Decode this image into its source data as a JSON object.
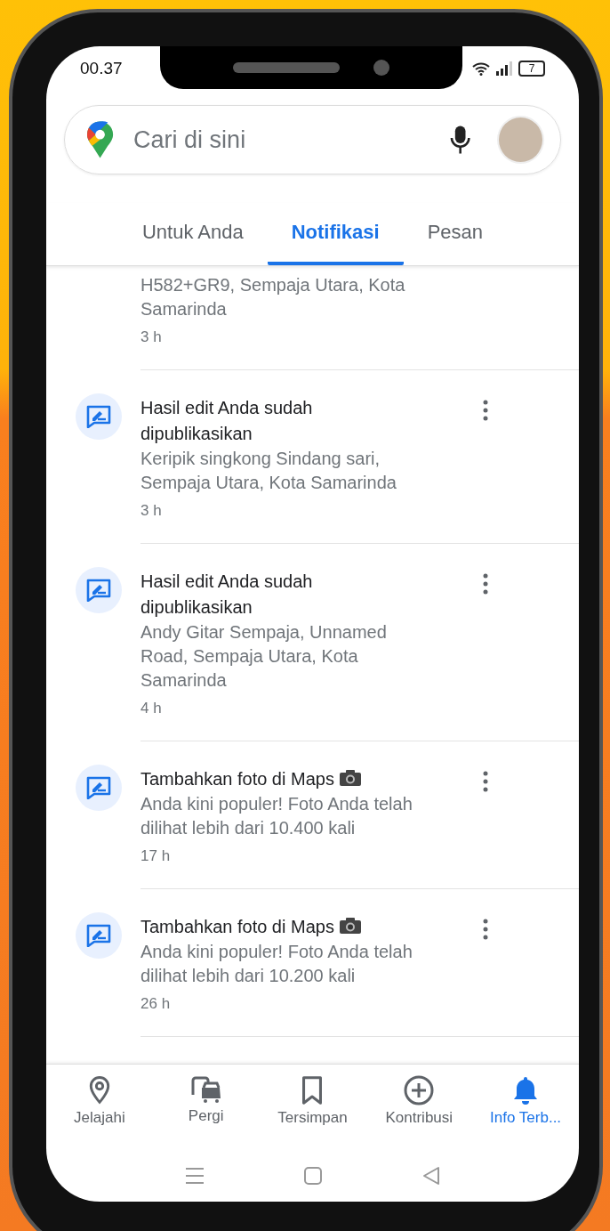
{
  "status_bar": {
    "time": "00.37",
    "battery": "7"
  },
  "search": {
    "placeholder": "Cari di sini"
  },
  "tabs": [
    {
      "label": "Untuk Anda",
      "selected": false
    },
    {
      "label": "Notifikasi",
      "selected": true
    },
    {
      "label": "Pesan",
      "selected": false
    }
  ],
  "notifications": [
    {
      "kind": "partial",
      "subtitle": "H582+GR9, Sempaja Utara, Kota Samarinda",
      "time": "3 h"
    },
    {
      "kind": "full",
      "title": "Hasil edit Anda sudah dipublikasikan",
      "camera": false,
      "subtitle": "Keripik singkong Sindang sari, Sempaja Utara, Kota Samarinda",
      "time": "3 h"
    },
    {
      "kind": "full",
      "title": "Hasil edit Anda sudah dipublikasikan",
      "camera": false,
      "subtitle": "Andy Gitar Sempaja, Unnamed Road, Sempaja Utara, Kota Samarinda",
      "time": "4 h"
    },
    {
      "kind": "full",
      "title": "Tambahkan foto di Maps",
      "camera": true,
      "subtitle": "Anda kini populer! Foto Anda telah dilihat lebih dari 10.400 kali",
      "time": "17 h"
    },
    {
      "kind": "full",
      "title": "Tambahkan foto di Maps",
      "camera": true,
      "subtitle": "Anda kini populer! Foto Anda telah dilihat lebih dari 10.200 kali",
      "time": "26 h"
    }
  ],
  "bottom_nav": [
    {
      "kind": "pin",
      "label": "Jelajahi",
      "selected": false
    },
    {
      "kind": "commute",
      "label": "Pergi",
      "selected": false
    },
    {
      "kind": "bookmark",
      "label": "Tersimpan",
      "selected": false
    },
    {
      "kind": "plus",
      "label": "Kontribusi",
      "selected": false
    },
    {
      "kind": "bell",
      "label": "Info Terb...",
      "selected": true
    }
  ]
}
